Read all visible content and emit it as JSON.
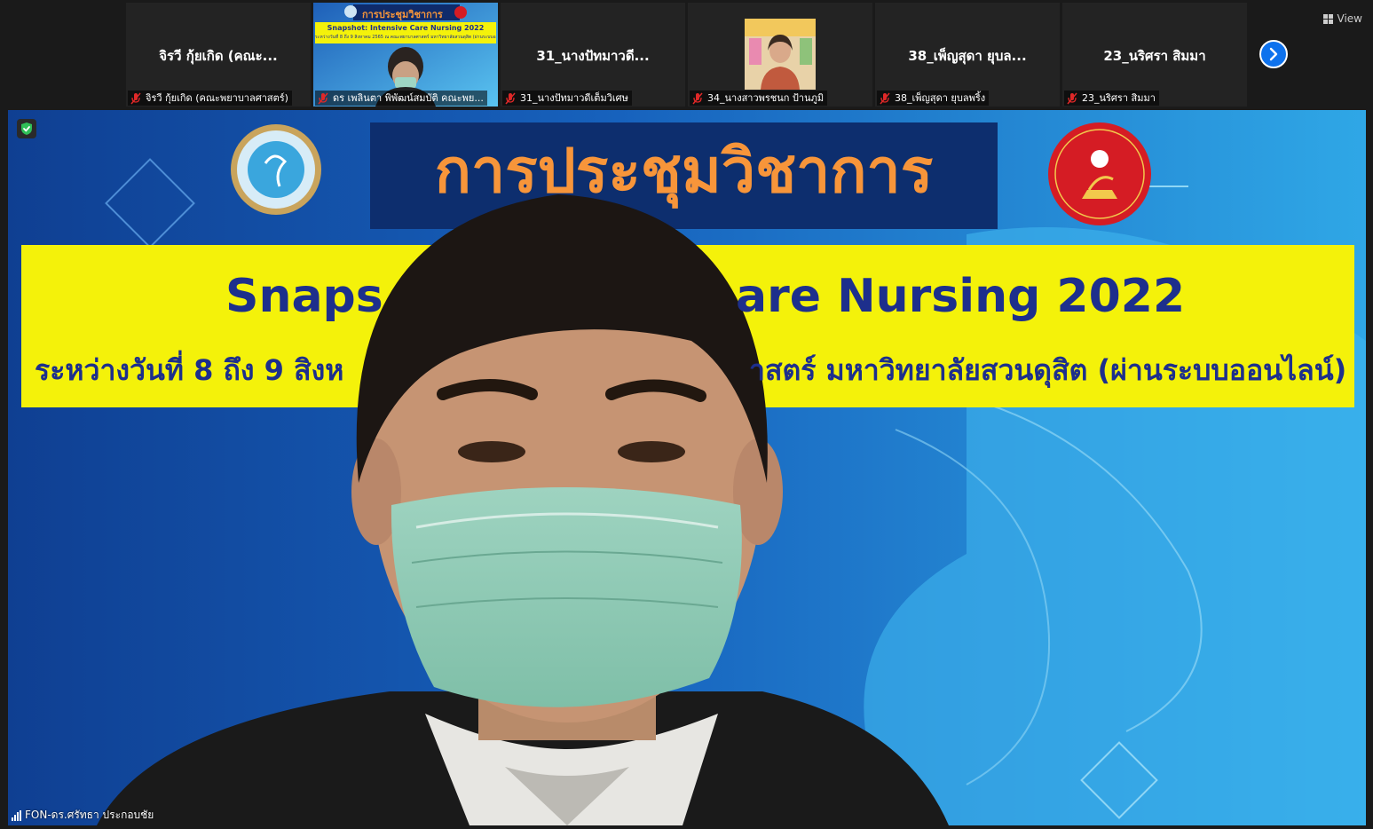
{
  "strip": {
    "tiles": [
      {
        "big_name": "จิรวี กุ้ยเกิด (คณะ...",
        "caption": "จิรวี กุ้ยเกิด (คณะพยาบาลศาสตร์)"
      },
      {
        "big_name": "",
        "caption": "ดร เพลินตา พิพัฒน์สมบัติ คณะพย...",
        "thumb": {
          "title": "การประชุมวิชาการ",
          "line1": "Snapshot: Intensive Care Nursing 2022",
          "line2": "ระหว่างวันที่ 8 ถึง 9 สิงหาคม 2565 ณ คณะพยาบาลศาสตร์ มหาวิทยาลัยสวนดุสิต (ผ่านระบบออนไลน์)"
        }
      },
      {
        "big_name": "31_นางปัทมาวดี...",
        "caption": "31_นางปัทมาวดีเต็มวิเศษ"
      },
      {
        "big_name": "",
        "caption": "34_นางสาวพรชนก ป้านภูมิ"
      },
      {
        "big_name": "38_เพ็ญสุดา ยุบล...",
        "caption": "38_เพ็ญสุดา ยุบลพริ้ง"
      },
      {
        "big_name": "23_นริศรา สิมมา",
        "caption": "23_นริศรา สิมมา"
      }
    ],
    "view_label": "View"
  },
  "main": {
    "banner_title": "การประชุมวิชาการ",
    "banner_line1_left": "Snaps",
    "banner_line1_right": "are Nursing 2022",
    "banner_line2_left": "ระหว่างวันที่ 8 ถึง 9 สิงห",
    "banner_line2_right": "าสตร์ มหาวิทยาลัยสวนดุสิต (ผ่านระบบออนไลน์)",
    "speaker_name": "FON-ดร.ศรัทธา ประกอบชัย"
  },
  "colors": {
    "accent": "#0e72ed",
    "banner_yellow": "#f4f20a",
    "banner_text": "#1d2f8c",
    "title_orange": "#f7953a",
    "background_blue": "#1b74c9"
  }
}
